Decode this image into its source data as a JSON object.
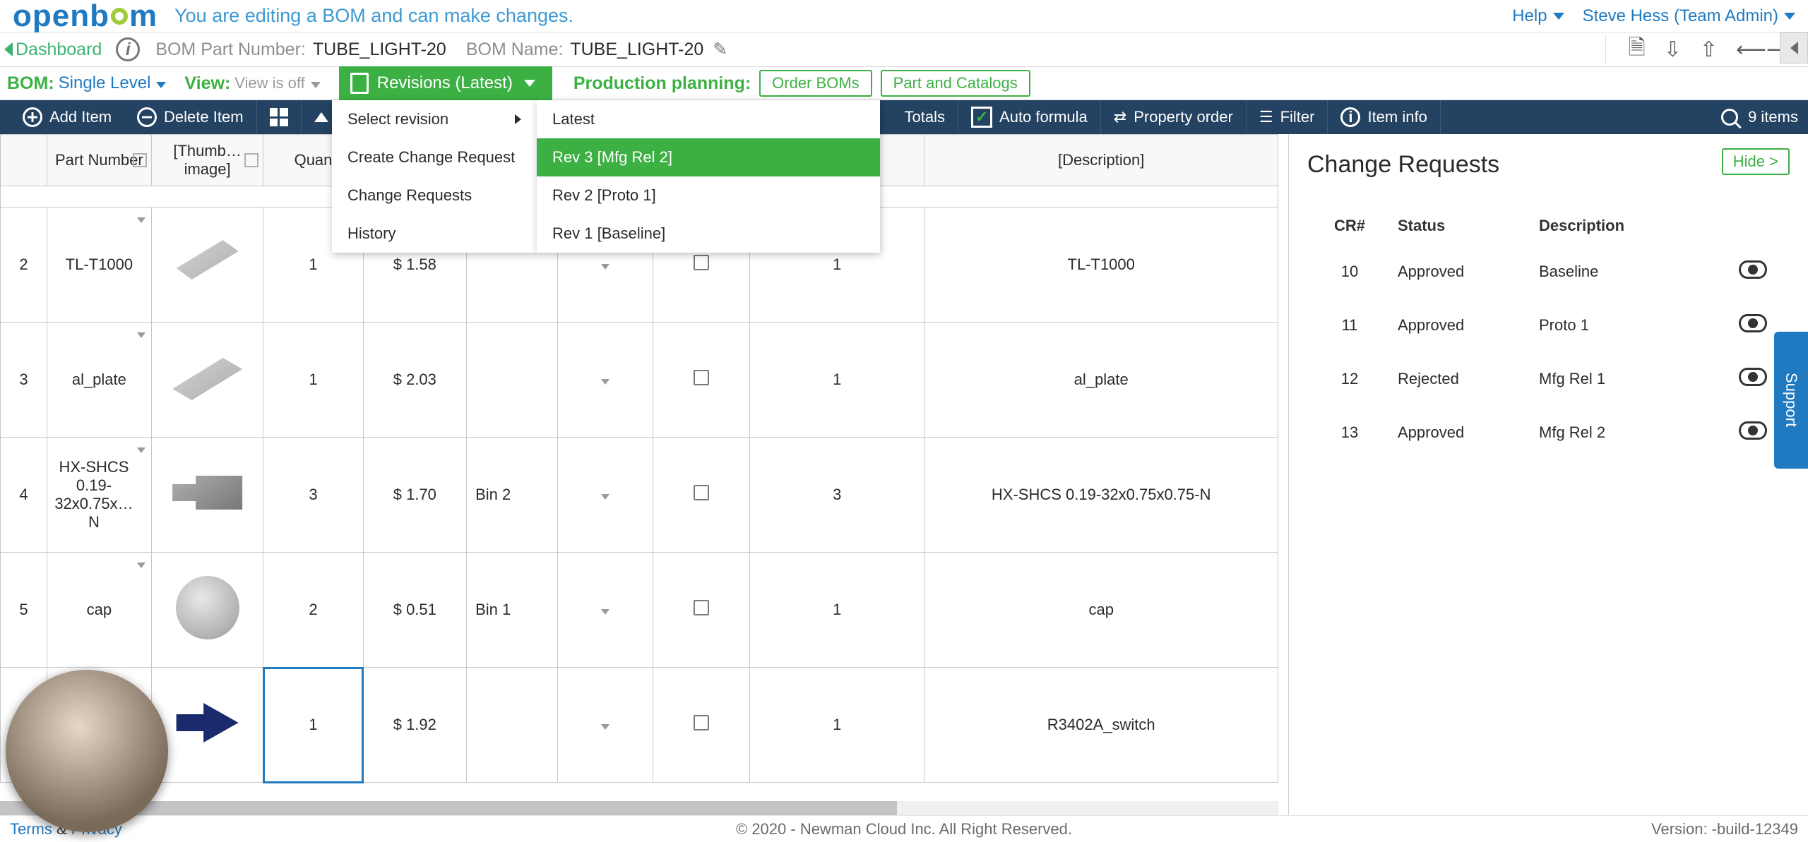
{
  "brand": {
    "name_a": "open",
    "name_b": "b",
    "name_c": "m"
  },
  "edit_message": "You are editing a BOM and can make changes.",
  "help_label": "Help",
  "user_label": "Steve Hess (Team Admin)",
  "dashboard_label": "Dashboard",
  "bom_pn_label": "BOM Part Number:",
  "bom_pn_value": "TUBE_LIGHT-20",
  "bom_name_label": "BOM Name:",
  "bom_name_value": "TUBE_LIGHT-20",
  "opt_bom_label": "BOM:",
  "opt_bom_value": "Single Level",
  "opt_view_label": "View:",
  "opt_view_value": "View is off",
  "rev_button_label": "Revisions (Latest)",
  "prod_plan_label": "Production planning:",
  "order_boms": "Order BOMs",
  "part_catalogs": "Part and Catalogs",
  "tool_add": "Add Item",
  "tool_delete": "Delete Item",
  "tool_totals": "Totals",
  "tool_auto": "Auto formula",
  "tool_prop": "Property order",
  "tool_filter": "Filter",
  "tool_info": "Item info",
  "items_count": "9 items",
  "cols": {
    "rownum": "",
    "part": "Part Number",
    "thumb": "[Thumb… image]",
    "qty": "Quan",
    "cost": "",
    "bin": "",
    "chk": "",
    "qty2": "",
    "desc": "[Description]"
  },
  "rows": [
    {
      "n": "2",
      "part": "TL-T1000",
      "qty": "1",
      "cost": "$ 1.58",
      "bin": "",
      "qty2": "1",
      "desc": "TL-T1000",
      "thumb_kind": "tube"
    },
    {
      "n": "3",
      "part": "al_plate",
      "qty": "1",
      "cost": "$ 2.03",
      "bin": "",
      "qty2": "1",
      "desc": "al_plate",
      "thumb_kind": "plate"
    },
    {
      "n": "4",
      "part": "HX-SHCS 0.19-32x0.75x…N",
      "qty": "3",
      "cost": "$ 1.70",
      "bin": "Bin 2",
      "qty2": "3",
      "desc": "HX-SHCS 0.19-32x0.75x0.75-N",
      "thumb_kind": "bolt"
    },
    {
      "n": "5",
      "part": "cap",
      "qty": "2",
      "cost": "$ 0.51",
      "bin": "Bin 1",
      "qty2": "1",
      "desc": "cap",
      "thumb_kind": "cap"
    },
    {
      "n": "",
      "part": "",
      "qty": "1",
      "cost": "$ 1.92",
      "bin": "",
      "qty2": "1",
      "desc": "R3402A_switch",
      "thumb_kind": "switch"
    }
  ],
  "menu1": {
    "select": "Select revision",
    "create": "Create Change Request",
    "requests": "Change Requests",
    "history": "History"
  },
  "menu2": {
    "latest": "Latest",
    "rev3": "Rev 3 [Mfg Rel 2]",
    "rev2": "Rev 2 [Proto 1]",
    "rev1": "Rev 1 [Baseline]"
  },
  "side": {
    "title": "Change Requests",
    "hide": "Hide >",
    "th_cr": "CR#",
    "th_status": "Status",
    "th_desc": "Description",
    "rows": [
      {
        "cr": "10",
        "status": "Approved",
        "desc": "Baseline"
      },
      {
        "cr": "11",
        "status": "Approved",
        "desc": "Proto 1"
      },
      {
        "cr": "12",
        "status": "Rejected",
        "desc": "Mfg Rel 1"
      },
      {
        "cr": "13",
        "status": "Approved",
        "desc": "Mfg Rel 2"
      }
    ]
  },
  "support_label": "Support",
  "footer_terms": "Terms",
  "footer_amp": " & ",
  "footer_privacy": "Privacy",
  "footer_copy": "© 2020 - Newman Cloud Inc. All Right Reserved.",
  "footer_version": "Version: -build-12349"
}
